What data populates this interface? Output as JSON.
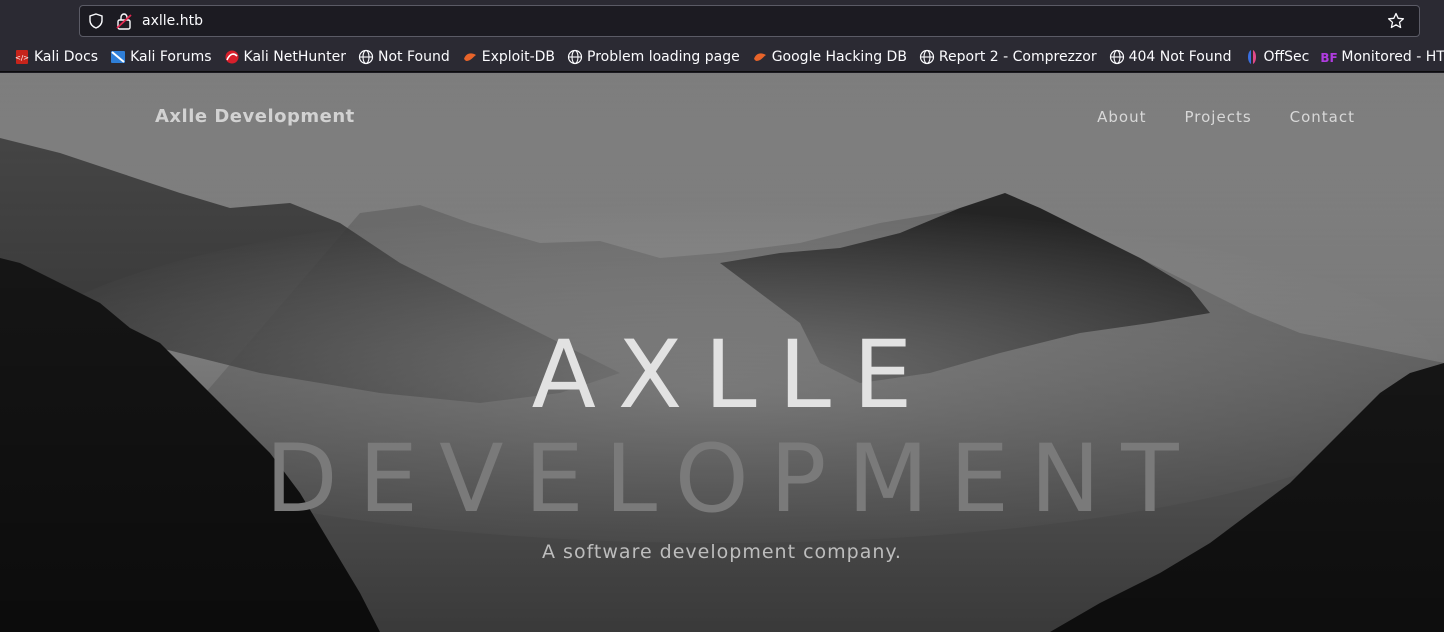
{
  "browser": {
    "url": "axlle.htb",
    "bookmarks": [
      {
        "label": "Kali Docs",
        "icon": "kali-docs-icon"
      },
      {
        "label": "Kali Forums",
        "icon": "kali-forums-icon"
      },
      {
        "label": "Kali NetHunter",
        "icon": "kali-nethunter-icon"
      },
      {
        "label": "Not Found",
        "icon": "globe-icon"
      },
      {
        "label": "Exploit-DB",
        "icon": "exploit-db-icon"
      },
      {
        "label": "Problem loading page",
        "icon": "globe-icon"
      },
      {
        "label": "Google Hacking DB",
        "icon": "exploit-db-icon"
      },
      {
        "label": "Report 2 - Comprezzor",
        "icon": "globe-icon"
      },
      {
        "label": "404 Not Found",
        "icon": "globe-icon"
      },
      {
        "label": "OffSec",
        "icon": "offsec-icon"
      },
      {
        "label": "Monitored - HTB | Bre…",
        "icon": "bf-icon"
      }
    ]
  },
  "site": {
    "brand": "Axlle Development",
    "nav": [
      "About",
      "Projects",
      "Contact"
    ],
    "hero": {
      "line1": "AXLLE",
      "line2": "DEVELOPMENT",
      "subtitle": "A software development company."
    }
  },
  "colors": {
    "chrome_bg": "#2b2a33",
    "urlbar_bg": "#1c1b22",
    "hero_text": "#e2e2e2"
  }
}
